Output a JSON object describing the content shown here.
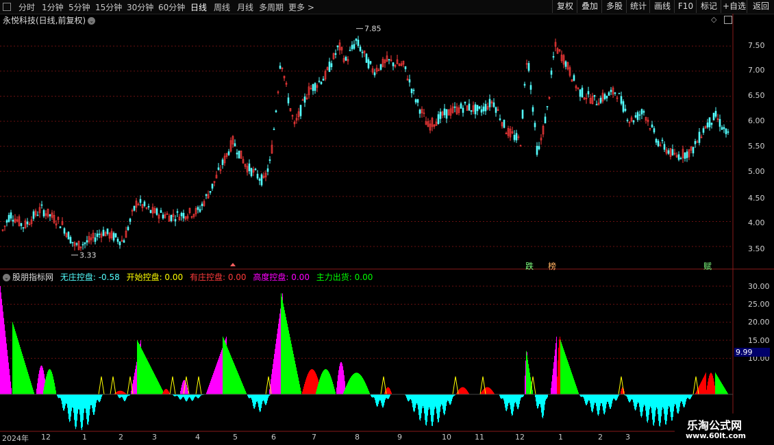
{
  "toolbar": {
    "timeframes": [
      "分时",
      "1分钟",
      "5分钟",
      "15分钟",
      "30分钟",
      "60分钟",
      "日线",
      "周线",
      "月线",
      "多周期",
      "更多"
    ],
    "active": "日线",
    "right_buttons": [
      "复权",
      "叠加",
      "多股",
      "统计",
      "画线",
      "F10",
      "标记",
      "+自选",
      "返回"
    ]
  },
  "chart_title": "永悦科技(日线,前复权)",
  "colors": {
    "up": "#ff3b3b",
    "down": "#54ffff",
    "grid": "#6a1010",
    "magenta": "#ff00ff",
    "green": "#00ff00",
    "red": "#ff0000",
    "cyan": "#00ffff",
    "yellow": "#ffff00"
  },
  "price_axis": [
    "7.50",
    "7.00",
    "6.50",
    "6.00",
    "5.50",
    "5.00",
    "4.50",
    "4.00",
    "3.50"
  ],
  "price_high": "7.85",
  "price_low": "3.33",
  "signals": [
    "跌",
    "榜",
    "赋"
  ],
  "indicator": {
    "name": "股朋指标网",
    "items": [
      {
        "label": "无庄控盘:",
        "value": "-0.58",
        "color": "#54ffff"
      },
      {
        "label": "开始控盘:",
        "value": "0.00",
        "color": "#ffff00"
      },
      {
        "label": "有庄控盘:",
        "value": "0.00",
        "color": "#ff3b3b"
      },
      {
        "label": "高度控盘:",
        "value": "0.00",
        "color": "#ff00ff"
      },
      {
        "label": "主力出货:",
        "value": "0.00",
        "color": "#00ff00"
      }
    ],
    "axis": [
      "30.00",
      "25.00",
      "20.00",
      "15.00",
      "10.00"
    ],
    "current": "9.99"
  },
  "timeline": {
    "year": "2024年",
    "months": [
      "12",
      "1",
      "2",
      "3",
      "4",
      "5",
      "6",
      "7",
      "8",
      "9",
      "10",
      "11",
      "12",
      "1",
      "2",
      "3"
    ]
  },
  "watermark": {
    "line1": "乐淘公式网",
    "line2": "www.60lt.com"
  },
  "chart_data": {
    "type": "candlestick+histogram",
    "price_ylim": [
      3.2,
      7.9
    ],
    "price_axis_ticks": [
      3.5,
      4.0,
      4.5,
      5.0,
      5.5,
      6.0,
      6.5,
      7.0,
      7.5
    ],
    "price_high": 7.85,
    "price_low": 3.33,
    "price_path": [
      [
        0,
        3.7
      ],
      [
        15,
        4.15
      ],
      [
        35,
        3.9
      ],
      [
        60,
        4.25
      ],
      [
        90,
        3.95
      ],
      [
        110,
        3.5
      ],
      [
        130,
        3.6
      ],
      [
        150,
        3.8
      ],
      [
        180,
        3.6
      ],
      [
        200,
        4.4
      ],
      [
        220,
        4.2
      ],
      [
        250,
        4.1
      ],
      [
        290,
        4.2
      ],
      [
        310,
        4.7
      ],
      [
        340,
        5.6
      ],
      [
        360,
        5.1
      ],
      [
        385,
        4.8
      ],
      [
        395,
        5.2
      ],
      [
        405,
        6.5
      ],
      [
        410,
        7.3
      ],
      [
        420,
        6.5
      ],
      [
        430,
        5.9
      ],
      [
        450,
        6.6
      ],
      [
        475,
        6.9
      ],
      [
        495,
        7.5
      ],
      [
        505,
        7.2
      ],
      [
        520,
        7.6
      ],
      [
        545,
        7.0
      ],
      [
        565,
        7.2
      ],
      [
        590,
        7.1
      ],
      [
        605,
        6.5
      ],
      [
        625,
        5.9
      ],
      [
        650,
        6.15
      ],
      [
        680,
        6.3
      ],
      [
        700,
        6.2
      ],
      [
        720,
        6.4
      ],
      [
        740,
        5.8
      ],
      [
        760,
        5.6
      ],
      [
        770,
        7.4
      ],
      [
        785,
        5.3
      ],
      [
        800,
        6.3
      ],
      [
        810,
        7.5
      ],
      [
        825,
        7.2
      ],
      [
        845,
        6.6
      ],
      [
        870,
        6.4
      ],
      [
        900,
        6.6
      ],
      [
        920,
        6.0
      ],
      [
        940,
        6.2
      ],
      [
        960,
        5.6
      ],
      [
        985,
        5.3
      ],
      [
        1010,
        5.4
      ],
      [
        1030,
        5.9
      ],
      [
        1045,
        6.1
      ],
      [
        1063,
        5.7
      ]
    ],
    "indicator_axis_ticks": [
      10,
      15,
      20,
      25,
      30
    ],
    "indicator_ylim": [
      -10,
      32
    ]
  }
}
